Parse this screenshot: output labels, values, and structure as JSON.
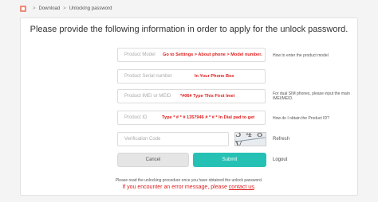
{
  "breadcrumb": {
    "items": [
      "Download",
      "Unlocking password"
    ],
    "separator": ">"
  },
  "title": "Please provide the following information in order to apply for the unlock password.",
  "form": {
    "product_model": {
      "placeholder": "Product Model",
      "note": "Go to Settings > About phone > Model number.",
      "help": "How to enter the product model"
    },
    "serial_number": {
      "placeholder": "Product Serial number",
      "note": "In Your Phone Box"
    },
    "imei": {
      "placeholder": "Product IMEI or MEID",
      "note": "*#06# Type This First Imei",
      "help": "For dual SIM phones, please input the main IMEI/MEID."
    },
    "product_id": {
      "placeholder": "Product ID",
      "note": "Type * # * # 1357946 # * # * In Dial pad to get",
      "help": "How do I obtain the Product ID?"
    },
    "verification": {
      "placeholder": "Verification Code",
      "captcha_text": "3 4 8 V",
      "refresh": "Refresh"
    }
  },
  "buttons": {
    "cancel": "Cancel",
    "submit": "Submit",
    "logout": "Logout"
  },
  "footer": {
    "note": "Please read the unlocking procedure once you have obtained the unlock password.",
    "error_prefix": "If you encounter an error message, please",
    "contact": "contact us",
    "error_suffix": "."
  },
  "colors": {
    "accent": "#26c1b5",
    "error": "#e02020"
  }
}
